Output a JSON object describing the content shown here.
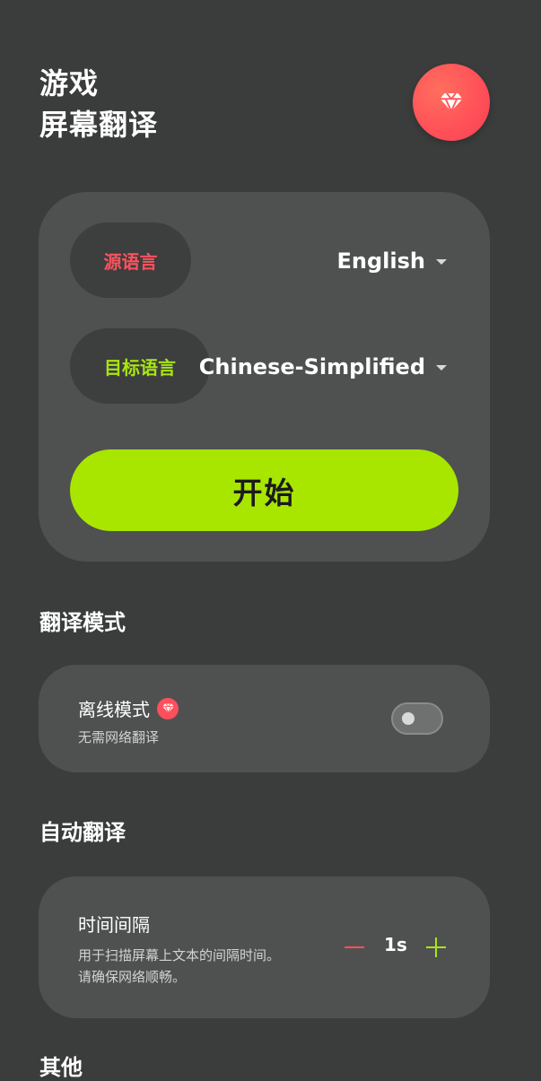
{
  "header": {
    "title_line1": "游戏",
    "title_line2": "屏幕翻译"
  },
  "language_card": {
    "source_label": "源语言",
    "source_value": "English",
    "target_label": "目标语言",
    "target_value": "Chinese-Simplified",
    "start_button": "开始"
  },
  "sections": {
    "mode_title": "翻译模式",
    "auto_title": "自动翻译",
    "other_title": "其他"
  },
  "offline_mode": {
    "title": "离线模式",
    "description": "无需网络翻译",
    "enabled": false
  },
  "time_interval": {
    "title": "时间间隔",
    "description_line1": "用于扫描屏幕上文本的间隔时间。",
    "description_line2": "请确保网络顺畅。",
    "value": "1s"
  },
  "colors": {
    "background": "#3b3c3c",
    "card": "#4f5151",
    "accent_green": "#a8e600",
    "accent_red": "#ff525e"
  },
  "icons": {
    "premium": "diamond-icon",
    "badge": "diamond-icon",
    "minus": "minus-icon",
    "plus": "plus-icon",
    "dropdown": "chevron-down-icon"
  }
}
